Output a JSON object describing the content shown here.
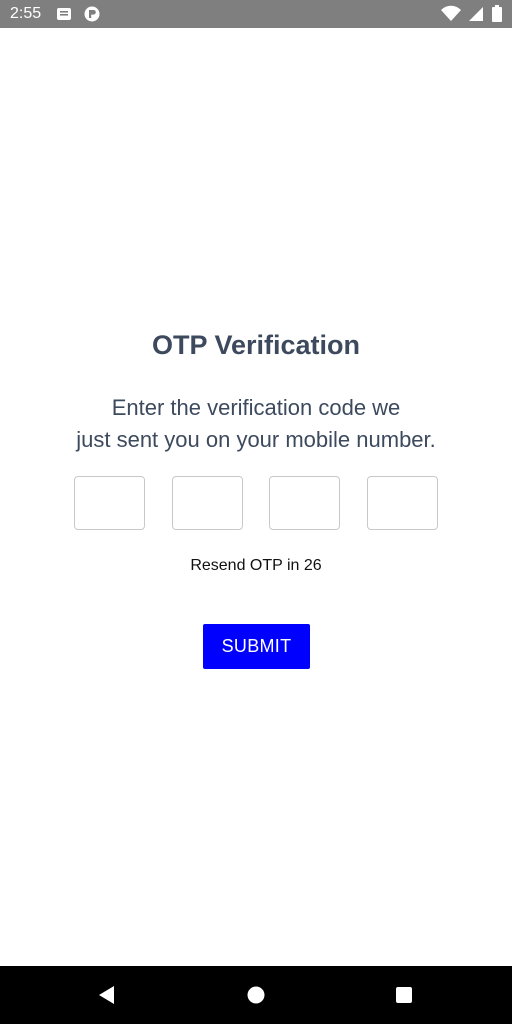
{
  "status_bar": {
    "time": "2:55",
    "icons": [
      "message-notification-icon",
      "app-notification-icon",
      "wifi-icon",
      "signal-icon",
      "battery-icon"
    ]
  },
  "otp": {
    "title": "OTP Verification",
    "instruction_line1": "Enter the verification code we",
    "instruction_line2": "just sent you on your mobile number.",
    "digits": [
      "",
      "",
      "",
      ""
    ],
    "resend_text": "Resend OTP in 26",
    "submit_label": "SUBMIT"
  },
  "nav_bar": {
    "buttons": [
      "back-icon",
      "home-icon",
      "recents-icon"
    ]
  },
  "colors": {
    "status_bar_bg": "#7f7f7f",
    "text_primary": "#3d4a5e",
    "submit_bg": "#0000ff",
    "nav_bar_bg": "#000000"
  }
}
